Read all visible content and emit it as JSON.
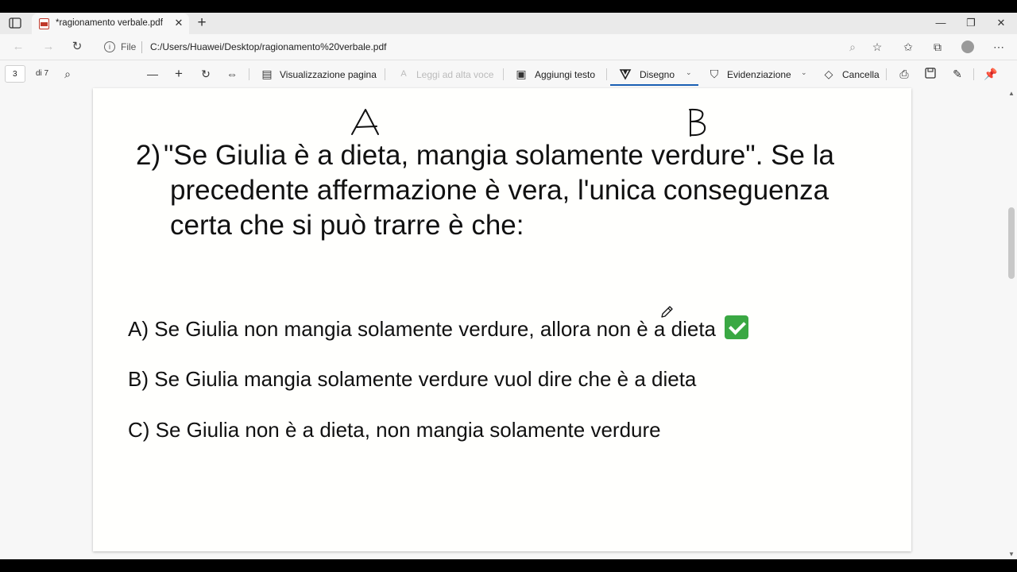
{
  "browser": {
    "tab_title": "*ragionamento verbale.pdf",
    "address": {
      "scheme_label": "File",
      "url": "C:/Users/Huawei/Desktop/ragionamento%20verbale.pdf"
    }
  },
  "pdf_toolbar": {
    "current_page": "3",
    "page_count": "di 7",
    "page_view_label": "Visualizzazione pagina",
    "read_aloud_label": "Leggi ad alta voce",
    "add_text_label": "Aggiungi testo",
    "draw_label": "Disegno",
    "highlight_label": "Evidenziazione",
    "erase_label": "Cancella"
  },
  "document": {
    "annotation_a": "A",
    "annotation_b": "B",
    "question_number": "2)",
    "question_lines": [
      "\"Se Giulia è a dieta, mangia solamente verdure\". Se la",
      "precedente affermazione è vera, l'unica conseguenza",
      "certa che si può trarre è che:"
    ],
    "answers": [
      {
        "text": "A) Se Giulia non mangia solamente verdure, allora non è a dieta",
        "correct": true
      },
      {
        "text": "B) Se Giulia mangia solamente verdure vuol dire che è a dieta",
        "correct": false
      },
      {
        "text": "C) Se Giulia non è a dieta, non mangia solamente verdure",
        "correct": false
      }
    ]
  },
  "colors": {
    "accent": "#1a5fb4",
    "check": "#3aa843"
  }
}
